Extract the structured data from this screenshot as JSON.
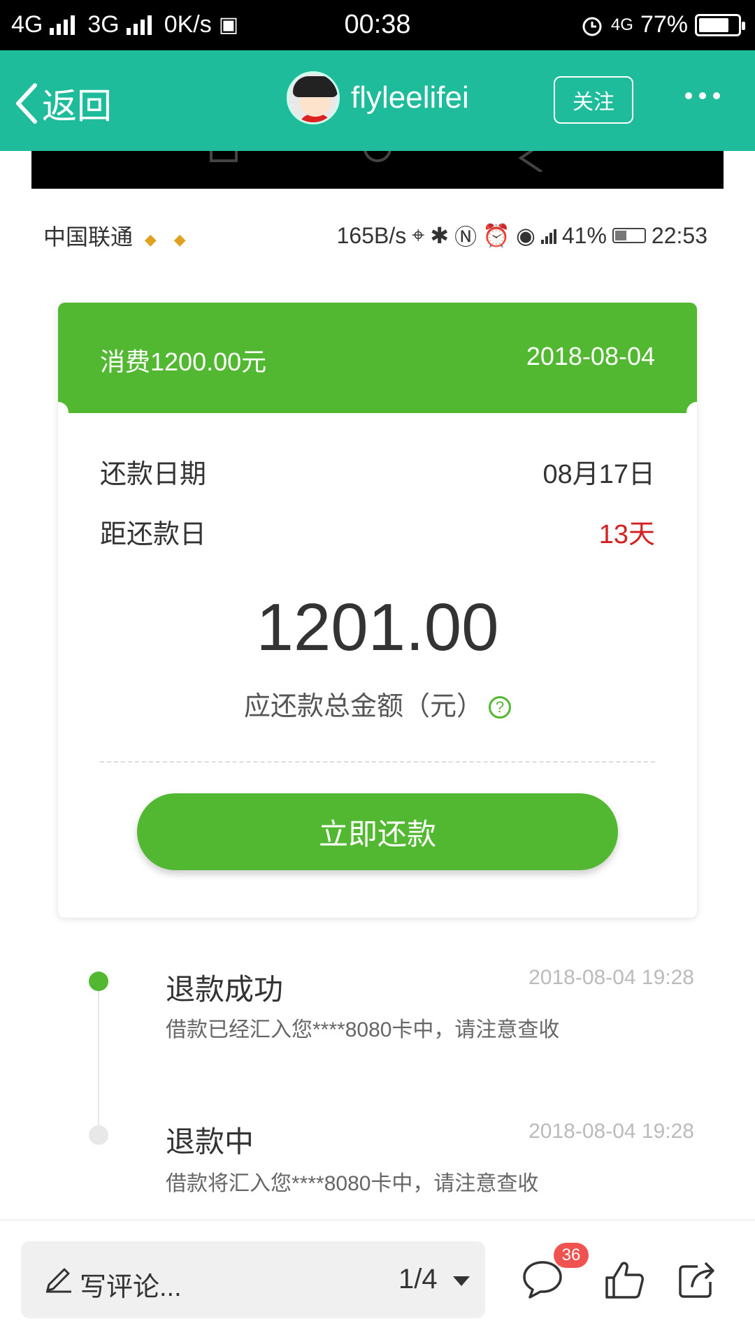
{
  "status_bar": {
    "network_1": "4G",
    "network_2": "3G",
    "speed": "0K/s",
    "time": "00:38",
    "network_3": "4G",
    "battery": "77%",
    "battery_level": 0.77
  },
  "header": {
    "back_label": "返回",
    "username": "flyleelifei",
    "follow_label": "关注"
  },
  "inner_status": {
    "carrier": "中国联通",
    "speed": "165B/s",
    "battery": "41%",
    "time": "22:53",
    "battery_level": 0.41
  },
  "bill": {
    "title": "消费1200.00元",
    "date": "2018-08-04",
    "repay_date_label": "还款日期",
    "repay_date_value": "08月17日",
    "days_left_label": "距还款日",
    "days_left_value": "13天",
    "amount": "1201.00",
    "amount_label": "应还款总金额（元）",
    "help_symbol": "?",
    "pay_button": "立即还款"
  },
  "timeline": [
    {
      "title": "退款成功",
      "time": "2018-08-04 19:28",
      "desc": "借款已经汇入您****8080卡中，请注意查收"
    },
    {
      "title": "退款中",
      "time": "2018-08-04 19:28",
      "desc": "借款将汇入您****8080卡中，请注意查收"
    }
  ],
  "bottom": {
    "comment_placeholder": "写评论...",
    "page_indicator": "1/4",
    "comment_count": "36"
  },
  "colors": {
    "header_teal": "#1ebc9a",
    "card_green": "#52b831",
    "alert_red": "#d32020"
  }
}
